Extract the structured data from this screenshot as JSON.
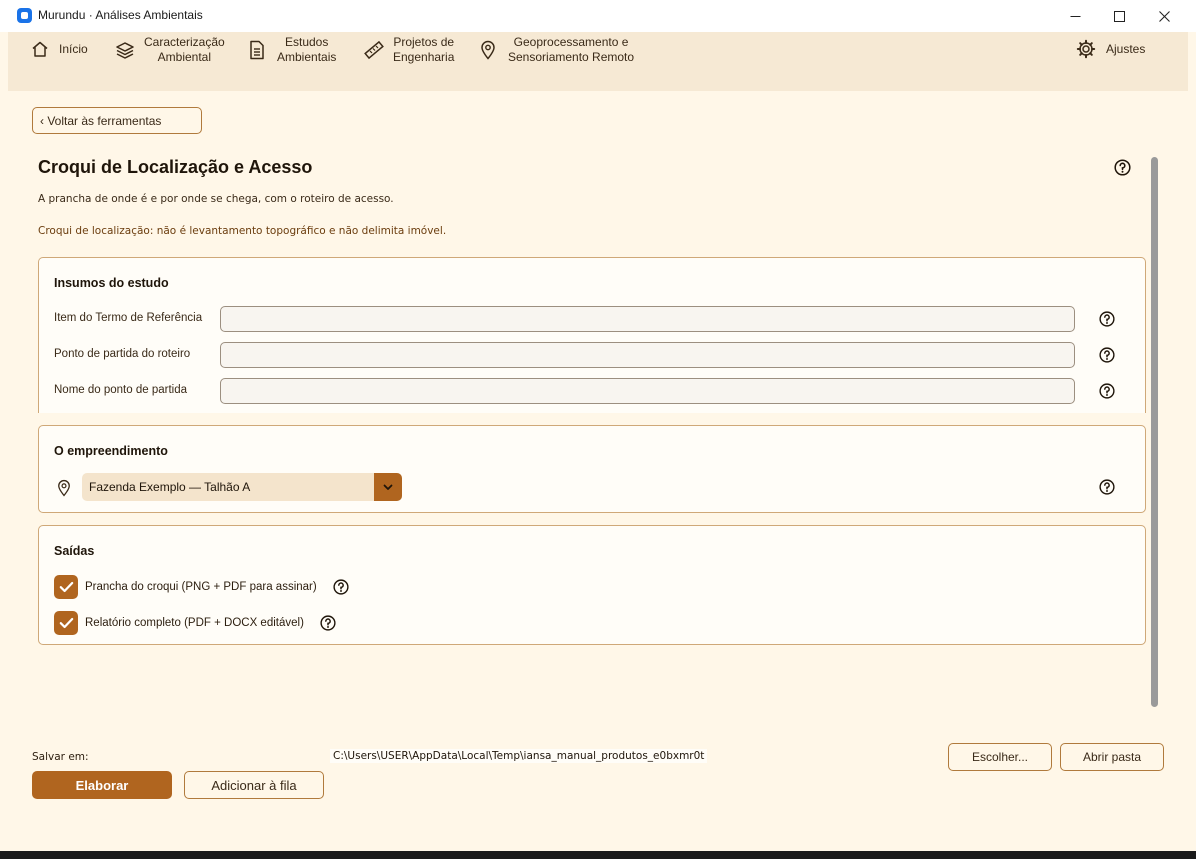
{
  "window": {
    "title": "Murundu · Análises Ambientais",
    "icon": "app-square-icon"
  },
  "nav": {
    "items": [
      {
        "label": "Início",
        "icon": "home-icon"
      },
      {
        "label": "Caracterização\nAmbiental",
        "icon": "layers-icon"
      },
      {
        "label": "Estudos\nAmbientais",
        "icon": "document-icon"
      },
      {
        "label": "Projetos de\nEngenharia",
        "icon": "ruler-icon"
      },
      {
        "label": "Geoprocessamento e\nSensoriamento Remoto",
        "icon": "location-pin-icon"
      }
    ],
    "settings": {
      "label": "Ajustes",
      "icon": "gear-icon"
    }
  },
  "back_button": "‹ Voltar às ferramentas",
  "page": {
    "title": "Croqui de Localização e Acesso",
    "subtitle": "A prancha de onde é e por onde se chega, com o roteiro de acesso.",
    "note": "Croqui de localização: não é levantamento topográfico e não delimita imóvel."
  },
  "inputs_panel": {
    "title": "Insumos do estudo",
    "fields": [
      {
        "label": "Item do Termo de Referência",
        "value": ""
      },
      {
        "label": "Ponto de partida do roteiro",
        "value": ""
      },
      {
        "label": "Nome do ponto de partida",
        "value": ""
      }
    ]
  },
  "project_panel": {
    "title": "O empreendimento",
    "selected": "Fazenda Exemplo — Talhão A"
  },
  "outputs_panel": {
    "title": "Saídas",
    "options": [
      {
        "label": "Prancha do croqui (PNG + PDF para assinar)",
        "checked": true
      },
      {
        "label": "Relatório completo (PDF + DOCX editável)",
        "checked": true
      }
    ]
  },
  "footer": {
    "save_label": "Salvar em:",
    "save_path": "C:\\Users\\USER\\AppData\\Local\\Temp\\iansa_manual_produtos_e0bxmr0t",
    "choose_label": "Escolher...",
    "open_folder_label": "Abrir pasta",
    "primary_label": "Elaborar",
    "queue_label": "Adicionar à fila"
  },
  "colors": {
    "accent": "#b0651f",
    "background": "#fff7e8",
    "nav_background": "#f6e9d4",
    "border": "#cfa878"
  }
}
